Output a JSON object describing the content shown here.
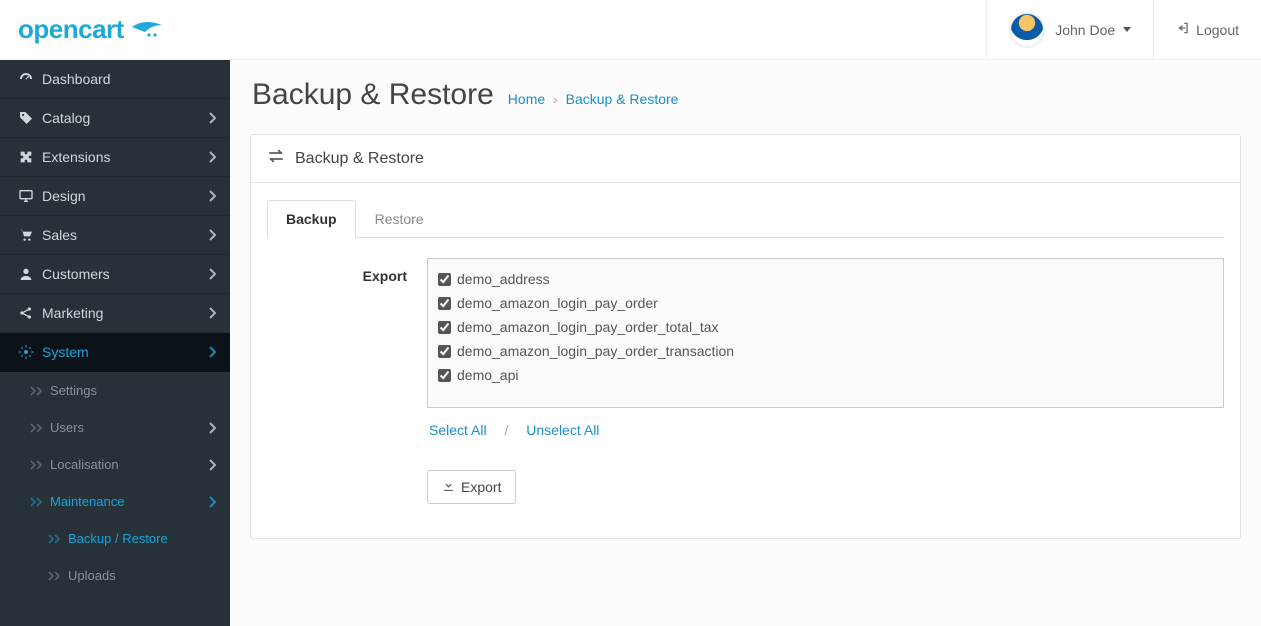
{
  "header": {
    "logo_text": "opencart",
    "user_name": "John Doe",
    "logout_label": "Logout"
  },
  "sidebar": {
    "items": [
      {
        "icon": "dashboard-icon",
        "label": "Dashboard",
        "expandable": false
      },
      {
        "icon": "tag-icon",
        "label": "Catalog",
        "expandable": true
      },
      {
        "icon": "puzzle-icon",
        "label": "Extensions",
        "expandable": true
      },
      {
        "icon": "desktop-icon",
        "label": "Design",
        "expandable": true
      },
      {
        "icon": "cart-icon",
        "label": "Sales",
        "expandable": true
      },
      {
        "icon": "user-icon",
        "label": "Customers",
        "expandable": true
      },
      {
        "icon": "share-icon",
        "label": "Marketing",
        "expandable": true
      },
      {
        "icon": "gear-icon",
        "label": "System",
        "expandable": true,
        "open": true
      }
    ],
    "system_sub": [
      {
        "label": "Settings",
        "expandable": false
      },
      {
        "label": "Users",
        "expandable": true
      },
      {
        "label": "Localisation",
        "expandable": true
      },
      {
        "label": "Maintenance",
        "expandable": true,
        "open": true
      }
    ],
    "maintenance_sub": [
      {
        "label": "Backup / Restore",
        "active": true
      },
      {
        "label": "Uploads"
      }
    ]
  },
  "page": {
    "title": "Backup & Restore",
    "breadcrumb_home": "Home",
    "breadcrumb_current": "Backup & Restore",
    "panel_title": "Backup & Restore"
  },
  "tabs": {
    "backup": "Backup",
    "restore": "Restore",
    "active": "backup"
  },
  "export": {
    "label": "Export",
    "select_all": "Select All",
    "unselect_all": "Unselect All",
    "button_label": "Export",
    "tables": [
      "demo_address",
      "demo_amazon_login_pay_order",
      "demo_amazon_login_pay_order_total_tax",
      "demo_amazon_login_pay_order_transaction",
      "demo_api"
    ]
  }
}
